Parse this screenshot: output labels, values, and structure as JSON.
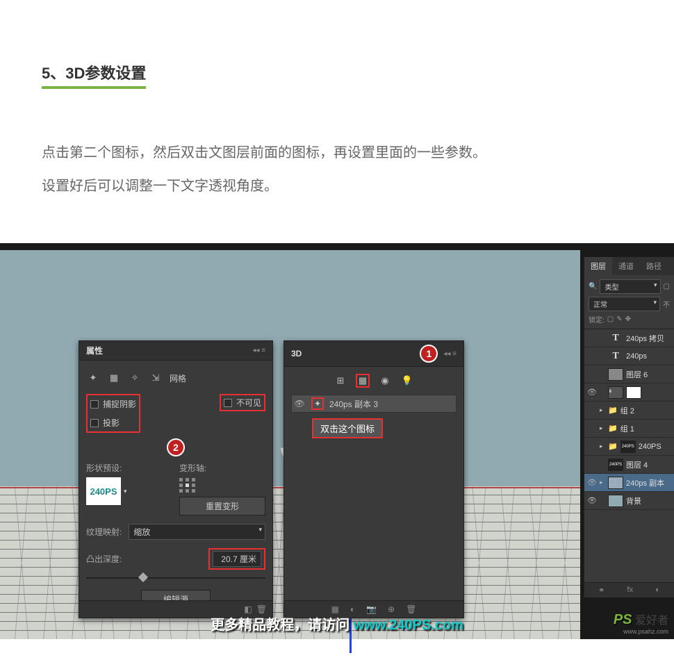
{
  "header": {
    "title": "5、3D参数设置",
    "desc_line1": "点击第二个图标，然后双击文图层前面的图标，再设置里面的一些参数。",
    "desc_line2": "设置好后可以调整一下文字透视角度。"
  },
  "canvas": {
    "text_3d": "S"
  },
  "props_panel": {
    "title": "属性",
    "mesh_label": "网格",
    "checks": {
      "capture_shadow": "捕捉阴影",
      "cast_shadow": "投影",
      "invisible": "不可见"
    },
    "badge2": "2",
    "shape_preset_label": "形状预设:",
    "preset_text": "240PS",
    "deform_axis_label": "变形轴:",
    "reset_deform": "重置变形",
    "texture_map_label": "纹理映射:",
    "texture_map_value": "缩放",
    "depth_label": "凸出深度:",
    "depth_value": "20.7 厘米",
    "edit_source": "编辑源"
  },
  "panel_3d": {
    "title": "3D",
    "badge1": "1",
    "item_name": "240ps 副本 3",
    "tooltip": "双击这个图标"
  },
  "layers": {
    "tabs": {
      "layers": "图层",
      "channels": "通道",
      "paths": "路径"
    },
    "kind_label": "类型",
    "blend_mode": "正常",
    "opacity_label": "不",
    "lock_label": "锁定:",
    "items": [
      {
        "name": "240ps 拷贝",
        "type": "text"
      },
      {
        "name": "240ps",
        "type": "text"
      },
      {
        "name": "图层 6",
        "type": "layer_gray"
      },
      {
        "name": "",
        "type": "mask_group"
      },
      {
        "name": "组 2",
        "type": "group"
      },
      {
        "name": "组 1",
        "type": "group"
      },
      {
        "name": "240PS",
        "type": "group_thumb"
      },
      {
        "name": "图层 4",
        "type": "layer_thumb"
      },
      {
        "name": "240ps 副本",
        "type": "3d",
        "active": true
      },
      {
        "name": "背景",
        "type": "bg"
      }
    ],
    "fx_label": "fx"
  },
  "footer": {
    "text": "更多精品教程，请访问 ",
    "link": "www.240PS.com"
  },
  "watermark": {
    "ps": "PS",
    "cn": "爱好者",
    "url": "www.psahz.com"
  }
}
